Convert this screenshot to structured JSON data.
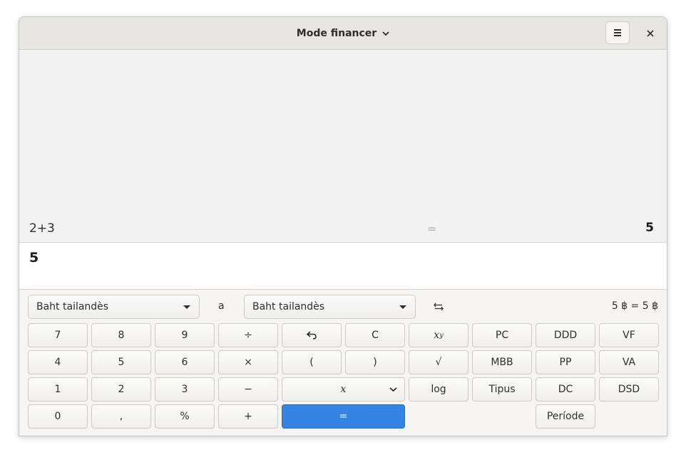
{
  "header": {
    "title": "Mode financer"
  },
  "history": {
    "expression": "2+3",
    "equals": "=",
    "result": "5"
  },
  "display": {
    "value": "5"
  },
  "conversion": {
    "from_currency": "Baht tailandès",
    "connector": "a",
    "to_currency": "Baht tailandès",
    "rate_text": "5 ฿ = 5 ฿"
  },
  "keys": {
    "k7": "7",
    "k8": "8",
    "k9": "9",
    "divide": "÷",
    "clear": "C",
    "pc": "PC",
    "ddd": "DDD",
    "vf": "VF",
    "k4": "4",
    "k5": "5",
    "k6": "6",
    "multiply": "×",
    "open_paren": "(",
    "close_paren": ")",
    "sqrt": "√",
    "mbb": "MBB",
    "pp": "PP",
    "va": "VA",
    "k1": "1",
    "k2": "2",
    "k3": "3",
    "minus": "−",
    "x_var": "x",
    "log": "log",
    "tipus": "Tipus",
    "dc": "DC",
    "dsd": "DSD",
    "k0": "0",
    "decimal": ",",
    "percent": "%",
    "plus": "+",
    "equals": "=",
    "periode": "Període",
    "power_base": "x",
    "power_exp": "y"
  },
  "colors": {
    "accent": "#3584e4"
  }
}
